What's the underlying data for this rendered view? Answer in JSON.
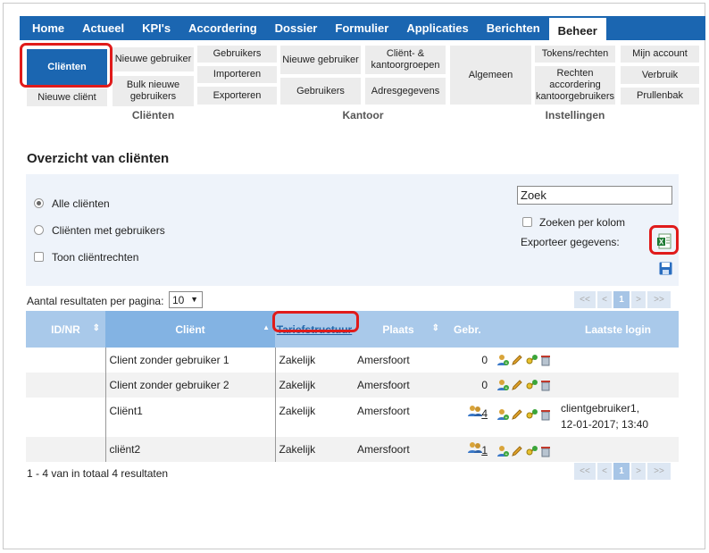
{
  "nav": {
    "tabs": [
      "Home",
      "Actueel",
      "KPI's",
      "Accordering",
      "Dossier",
      "Formulier",
      "Applicaties",
      "Berichten",
      "Beheer"
    ],
    "active": "Beheer"
  },
  "ribbon": {
    "clienten": {
      "clienten": "Cliënten",
      "nieuwe_gebruiker": "Nieuwe gebruiker",
      "bulk": "Bulk nieuwe gebruikers",
      "nieuwe_client": "Nieuwe cliënt",
      "group": "Cliënten"
    },
    "kantoor": {
      "gebruikers": "Gebruikers",
      "importeren": "Importeren",
      "exporteren": "Exporteren",
      "nieuwe_gebruiker": "Nieuwe gebruiker",
      "gebruikers2": "Gebruikers",
      "client_kantoorgroepen": "Cliënt- & kantoorgroepen",
      "adresgegevens": "Adresgegevens",
      "group": "Kantoor"
    },
    "instellingen": {
      "algemeen": "Algemeen",
      "tokens": "Tokens/rechten",
      "rechten": "Rechten accordering kantoorgebruikers",
      "mijn_account": "Mijn account",
      "verbruik": "Verbruik",
      "prullenbak": "Prullenbak",
      "group": "Instellingen"
    }
  },
  "page_title": "Overzicht van cliënten",
  "filters": {
    "alle": "Alle cliënten",
    "met_gebruikers": "Cliënten met gebruikers",
    "toon_rechten": "Toon cliëntrechten",
    "search_value": "Zoek",
    "zoeken_per_kolom": "Zoeken per kolom",
    "exporteer": "Exporteer gegevens:"
  },
  "pagination": {
    "label": "Aantal resultaten per pagina:",
    "per_page": "10",
    "buttons": [
      "<<",
      "<",
      "1",
      ">",
      ">>"
    ],
    "current": "1"
  },
  "table": {
    "headers": [
      "ID/NR",
      "Cliënt",
      "Tariefstructuur",
      "Plaats",
      "Gebr.",
      "Laatste login"
    ],
    "rows": [
      {
        "id": "",
        "client": "Client zonder gebruiker 1",
        "tarief": "Zakelijk",
        "plaats": "Amersfoort",
        "gebr": "0",
        "login1": "",
        "login2": ""
      },
      {
        "id": "",
        "client": "Client zonder gebruiker 2",
        "tarief": "Zakelijk",
        "plaats": "Amersfoort",
        "gebr": "0",
        "login1": "",
        "login2": ""
      },
      {
        "id": "",
        "client": "Cliënt1",
        "tarief": "Zakelijk",
        "plaats": "Amersfoort",
        "gebr": "4",
        "login1": "clientgebruiker1,",
        "login2": "12-01-2017; 13:40"
      },
      {
        "id": "",
        "client": "cliënt2",
        "tarief": "Zakelijk",
        "plaats": "Amersfoort",
        "gebr": "1",
        "login1": "",
        "login2": ""
      }
    ]
  },
  "footer": "1 - 4 van in totaal 4 resultaten",
  "colors": {
    "nav": "#1b66b1",
    "highlight": "#e01b1b",
    "header": "#a9c9ea"
  }
}
